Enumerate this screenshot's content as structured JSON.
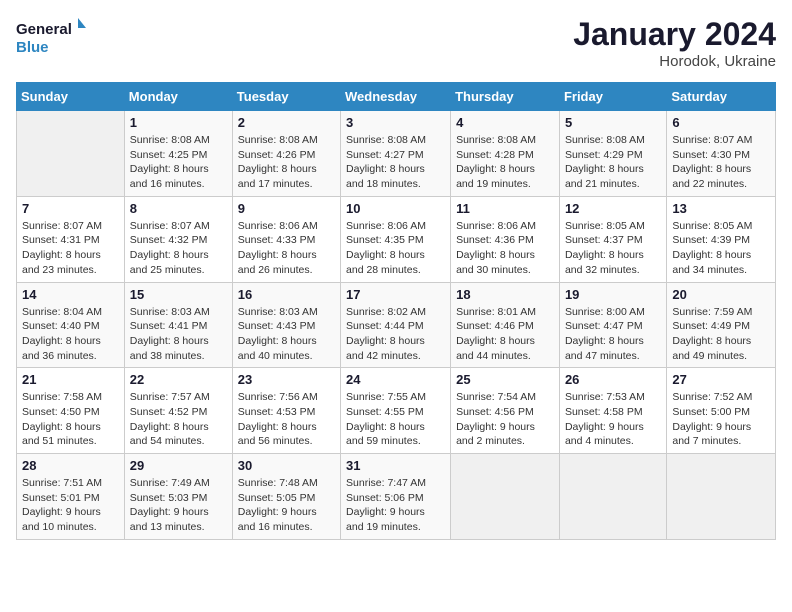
{
  "header": {
    "logo_line1": "General",
    "logo_line2": "Blue",
    "month_year": "January 2024",
    "location": "Horodok, Ukraine"
  },
  "columns": [
    "Sunday",
    "Monday",
    "Tuesday",
    "Wednesday",
    "Thursday",
    "Friday",
    "Saturday"
  ],
  "weeks": [
    [
      {
        "day": "",
        "info": ""
      },
      {
        "day": "1",
        "info": "Sunrise: 8:08 AM\nSunset: 4:25 PM\nDaylight: 8 hours\nand 16 minutes."
      },
      {
        "day": "2",
        "info": "Sunrise: 8:08 AM\nSunset: 4:26 PM\nDaylight: 8 hours\nand 17 minutes."
      },
      {
        "day": "3",
        "info": "Sunrise: 8:08 AM\nSunset: 4:27 PM\nDaylight: 8 hours\nand 18 minutes."
      },
      {
        "day": "4",
        "info": "Sunrise: 8:08 AM\nSunset: 4:28 PM\nDaylight: 8 hours\nand 19 minutes."
      },
      {
        "day": "5",
        "info": "Sunrise: 8:08 AM\nSunset: 4:29 PM\nDaylight: 8 hours\nand 21 minutes."
      },
      {
        "day": "6",
        "info": "Sunrise: 8:07 AM\nSunset: 4:30 PM\nDaylight: 8 hours\nand 22 minutes."
      }
    ],
    [
      {
        "day": "7",
        "info": "Sunrise: 8:07 AM\nSunset: 4:31 PM\nDaylight: 8 hours\nand 23 minutes."
      },
      {
        "day": "8",
        "info": "Sunrise: 8:07 AM\nSunset: 4:32 PM\nDaylight: 8 hours\nand 25 minutes."
      },
      {
        "day": "9",
        "info": "Sunrise: 8:06 AM\nSunset: 4:33 PM\nDaylight: 8 hours\nand 26 minutes."
      },
      {
        "day": "10",
        "info": "Sunrise: 8:06 AM\nSunset: 4:35 PM\nDaylight: 8 hours\nand 28 minutes."
      },
      {
        "day": "11",
        "info": "Sunrise: 8:06 AM\nSunset: 4:36 PM\nDaylight: 8 hours\nand 30 minutes."
      },
      {
        "day": "12",
        "info": "Sunrise: 8:05 AM\nSunset: 4:37 PM\nDaylight: 8 hours\nand 32 minutes."
      },
      {
        "day": "13",
        "info": "Sunrise: 8:05 AM\nSunset: 4:39 PM\nDaylight: 8 hours\nand 34 minutes."
      }
    ],
    [
      {
        "day": "14",
        "info": "Sunrise: 8:04 AM\nSunset: 4:40 PM\nDaylight: 8 hours\nand 36 minutes."
      },
      {
        "day": "15",
        "info": "Sunrise: 8:03 AM\nSunset: 4:41 PM\nDaylight: 8 hours\nand 38 minutes."
      },
      {
        "day": "16",
        "info": "Sunrise: 8:03 AM\nSunset: 4:43 PM\nDaylight: 8 hours\nand 40 minutes."
      },
      {
        "day": "17",
        "info": "Sunrise: 8:02 AM\nSunset: 4:44 PM\nDaylight: 8 hours\nand 42 minutes."
      },
      {
        "day": "18",
        "info": "Sunrise: 8:01 AM\nSunset: 4:46 PM\nDaylight: 8 hours\nand 44 minutes."
      },
      {
        "day": "19",
        "info": "Sunrise: 8:00 AM\nSunset: 4:47 PM\nDaylight: 8 hours\nand 47 minutes."
      },
      {
        "day": "20",
        "info": "Sunrise: 7:59 AM\nSunset: 4:49 PM\nDaylight: 8 hours\nand 49 minutes."
      }
    ],
    [
      {
        "day": "21",
        "info": "Sunrise: 7:58 AM\nSunset: 4:50 PM\nDaylight: 8 hours\nand 51 minutes."
      },
      {
        "day": "22",
        "info": "Sunrise: 7:57 AM\nSunset: 4:52 PM\nDaylight: 8 hours\nand 54 minutes."
      },
      {
        "day": "23",
        "info": "Sunrise: 7:56 AM\nSunset: 4:53 PM\nDaylight: 8 hours\nand 56 minutes."
      },
      {
        "day": "24",
        "info": "Sunrise: 7:55 AM\nSunset: 4:55 PM\nDaylight: 8 hours\nand 59 minutes."
      },
      {
        "day": "25",
        "info": "Sunrise: 7:54 AM\nSunset: 4:56 PM\nDaylight: 9 hours\nand 2 minutes."
      },
      {
        "day": "26",
        "info": "Sunrise: 7:53 AM\nSunset: 4:58 PM\nDaylight: 9 hours\nand 4 minutes."
      },
      {
        "day": "27",
        "info": "Sunrise: 7:52 AM\nSunset: 5:00 PM\nDaylight: 9 hours\nand 7 minutes."
      }
    ],
    [
      {
        "day": "28",
        "info": "Sunrise: 7:51 AM\nSunset: 5:01 PM\nDaylight: 9 hours\nand 10 minutes."
      },
      {
        "day": "29",
        "info": "Sunrise: 7:49 AM\nSunset: 5:03 PM\nDaylight: 9 hours\nand 13 minutes."
      },
      {
        "day": "30",
        "info": "Sunrise: 7:48 AM\nSunset: 5:05 PM\nDaylight: 9 hours\nand 16 minutes."
      },
      {
        "day": "31",
        "info": "Sunrise: 7:47 AM\nSunset: 5:06 PM\nDaylight: 9 hours\nand 19 minutes."
      },
      {
        "day": "",
        "info": ""
      },
      {
        "day": "",
        "info": ""
      },
      {
        "day": "",
        "info": ""
      }
    ]
  ]
}
